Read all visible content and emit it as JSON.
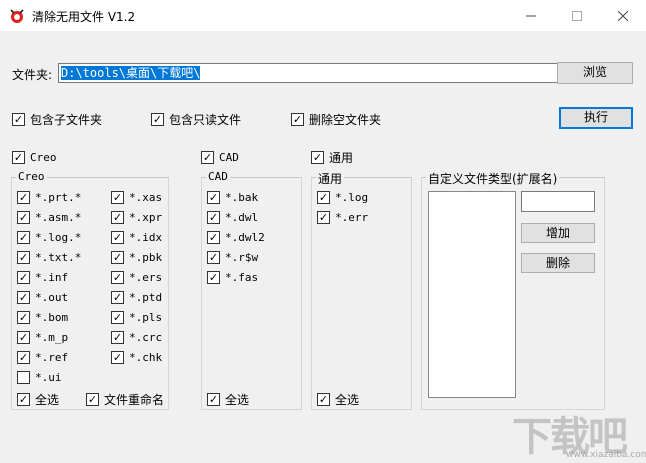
{
  "window": {
    "title": "清除无用文件  V1.2"
  },
  "path": {
    "label": "文件夹:",
    "value": "D:\\tools\\桌面\\下载吧\\",
    "browse": "浏览"
  },
  "options": {
    "include_sub": "包含子文件夹",
    "include_readonly": "包含只读文件",
    "delete_empty": "删除空文件夹",
    "run": "执行"
  },
  "creo": {
    "toggle": "Creo",
    "group": "Creo",
    "col1": [
      "*.prt.*",
      "*.asm.*",
      "*.log.*",
      "*.txt.*",
      "*.inf",
      "*.out",
      "*.bom",
      "*.m_p",
      "*.ref",
      "*.ui"
    ],
    "col2": [
      "*.xas",
      "*.xpr",
      "*.idx",
      "*.pbk",
      "*.ers",
      "*.ptd",
      "*.pls",
      "*.crc",
      "*.chk"
    ],
    "select_all": "全选",
    "rename": "文件重命名"
  },
  "cad": {
    "toggle": "CAD",
    "group": "CAD",
    "items": [
      "*.bak",
      "*.dwl",
      "*.dwl2",
      "*.r$w",
      "*.fas"
    ],
    "select_all": "全选"
  },
  "general": {
    "toggle": "通用",
    "group": "通用",
    "items": [
      "*.log",
      "*.err"
    ],
    "select_all": "全选"
  },
  "custom": {
    "group": "自定义文件类型(扩展名)",
    "add": "增加",
    "delete": "删除"
  },
  "watermark": {
    "text": "下载吧",
    "url": "www.xiazaiba.com"
  }
}
